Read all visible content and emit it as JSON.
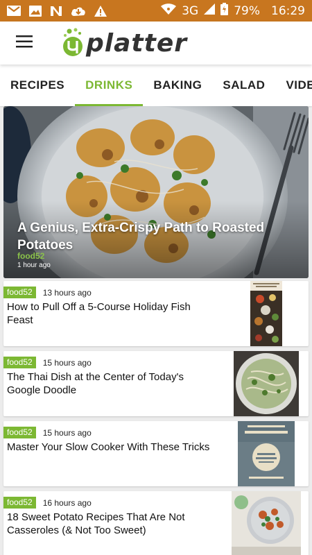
{
  "status_bar": {
    "network": "3G",
    "battery": "79%",
    "time": "16:29"
  },
  "app_bar": {
    "logo_text": "platter"
  },
  "tabs": [
    {
      "label": "RECIPES",
      "active": false
    },
    {
      "label": "DRINKS",
      "active": true
    },
    {
      "label": "BAKING",
      "active": false
    },
    {
      "label": "SALAD",
      "active": false
    },
    {
      "label": "VIDEOS",
      "active": false
    }
  ],
  "hero": {
    "title": "A Genius, Extra-Crispy Path to Roasted Potatoes",
    "source": "food52",
    "time": "1 hour ago"
  },
  "articles": [
    {
      "source": "food52",
      "time": "13 hours ago",
      "title": "How to Pull Off a 5-Course Holiday Fish Feast"
    },
    {
      "source": "food52",
      "time": "15 hours ago",
      "title": "The Thai Dish at the Center of Today's Google Doodle"
    },
    {
      "source": "food52",
      "time": "15 hours ago",
      "title": "Master Your Slow Cooker With These Tricks"
    },
    {
      "source": "food52",
      "time": "16 hours ago",
      "title": "18 Sweet Potato Recipes That Are Not Casseroles (& Not Too Sweet)"
    }
  ],
  "colors": {
    "status_bar": "#c8761f",
    "accent": "#7cb833"
  }
}
